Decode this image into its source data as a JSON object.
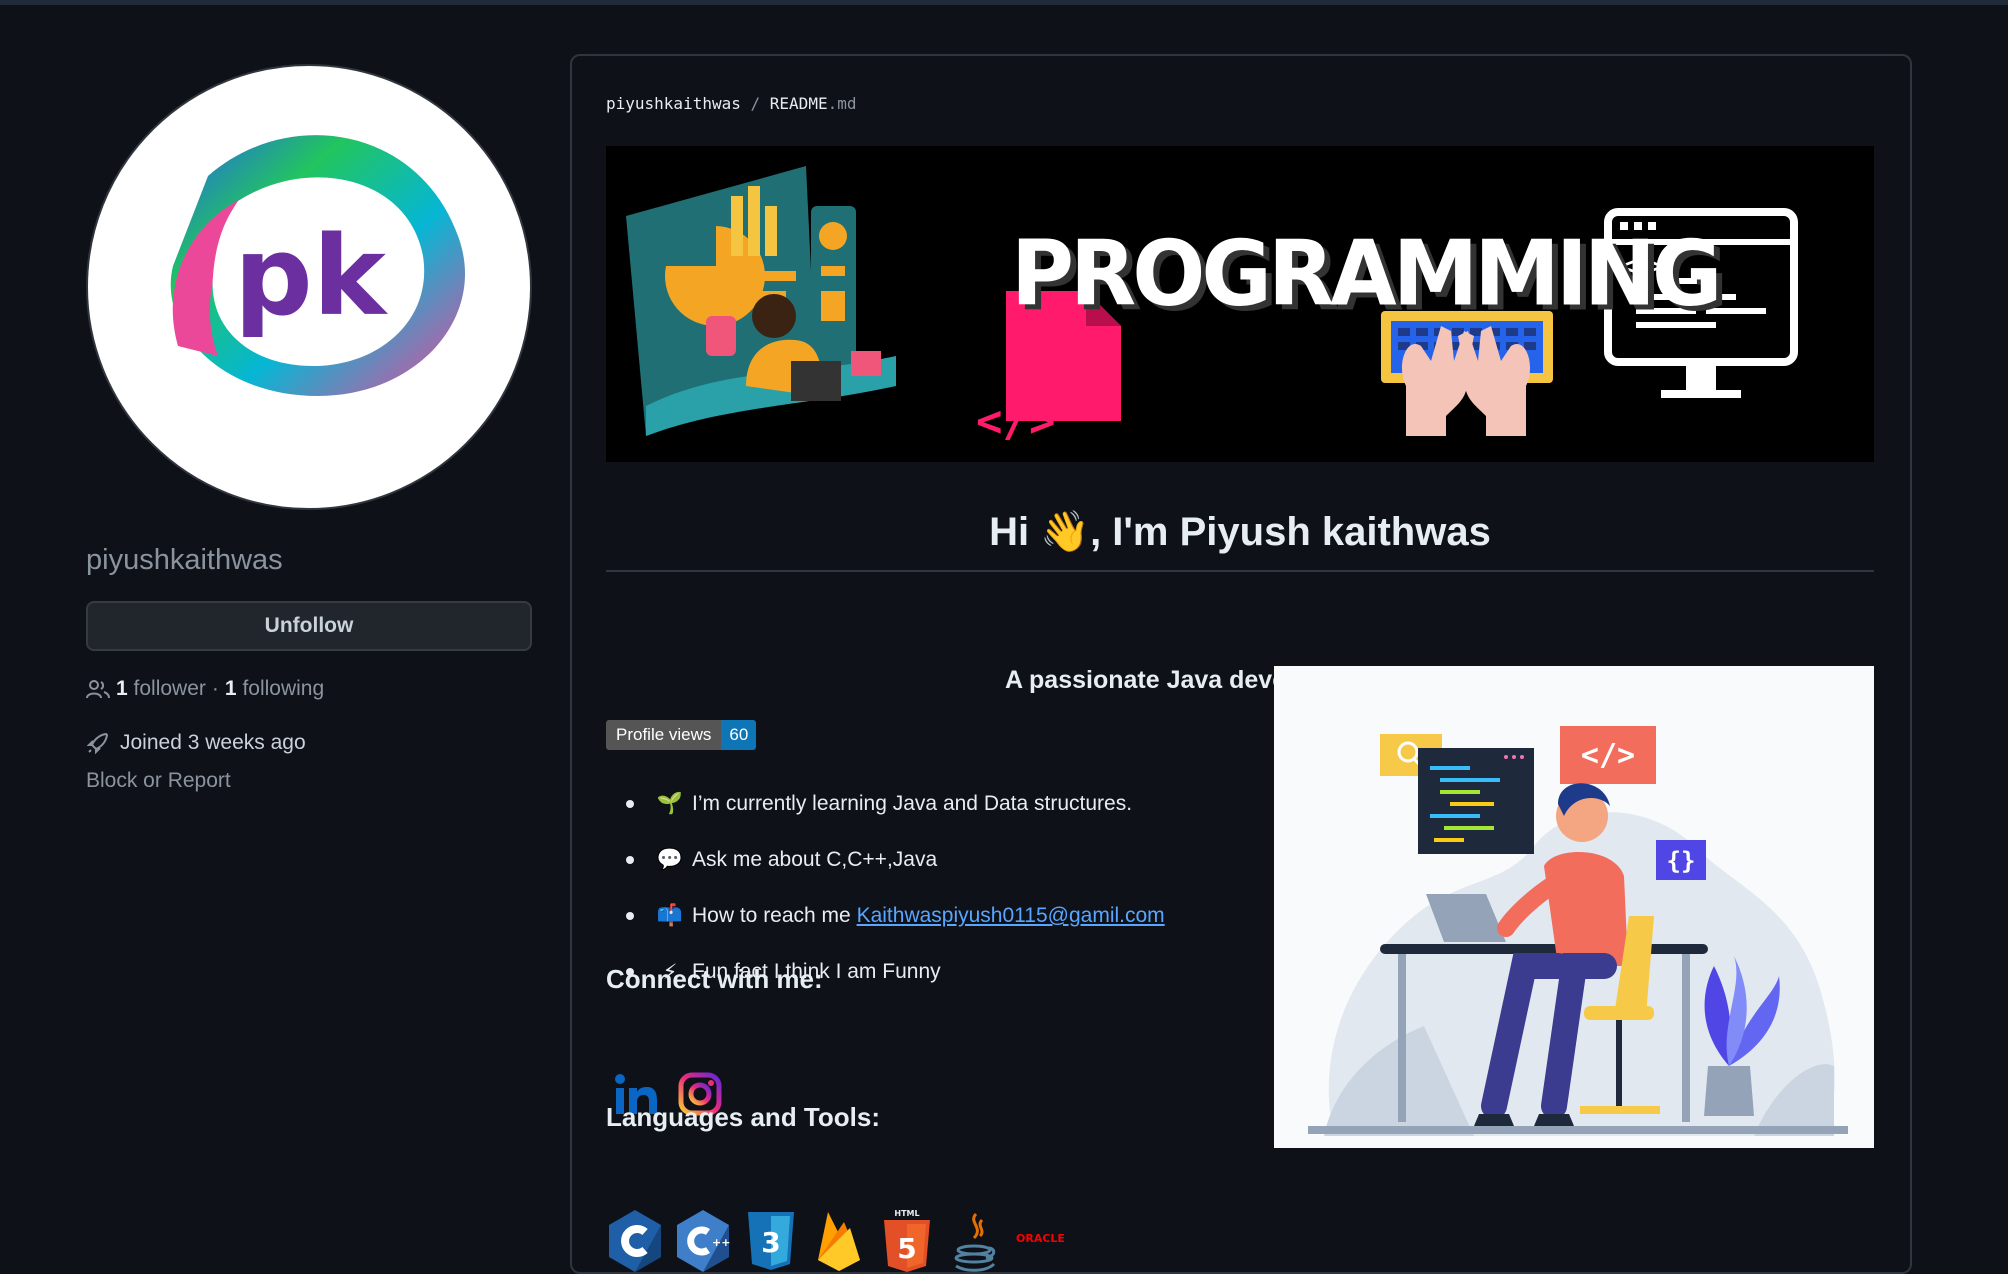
{
  "profile": {
    "avatar_text": "pk",
    "username": "piyushkaithwas",
    "unfollow_label": "Unfollow",
    "followers_count": "1",
    "followers_label": "follower",
    "separator": "·",
    "following_count": "1",
    "following_label": "following",
    "joined_label": "Joined",
    "joined_value": "3 weeks ago",
    "block_report": "Block or Report"
  },
  "readme": {
    "crumb_user": "piyushkaithwas",
    "crumb_sep": "/",
    "crumb_file": "README",
    "crumb_ext": ".md",
    "banner_text": "PROGRAMMING",
    "heading": "Hi 👋, I'm Piyush kaithwas",
    "subtitle": "A passionate Java developer from India",
    "badge_label": "Profile views",
    "badge_count": "60",
    "facts": [
      {
        "icon": "seedling-icon",
        "glyph": "🌱",
        "prefix": "I’m currently learning ",
        "bold": "Java and Data structures.",
        "link": ""
      },
      {
        "icon": "speech-bubble-icon",
        "glyph": "💬",
        "prefix": "Ask me about ",
        "bold": "C,C++,Java",
        "link": ""
      },
      {
        "icon": "mailbox-icon",
        "glyph": "📫",
        "prefix": "How to reach me ",
        "bold": "",
        "link": "Kaithwaspiyush0115@gamil.com"
      },
      {
        "icon": "lightning-icon",
        "glyph": "⚡",
        "prefix": "Fun fact ",
        "bold": "I think I am Funny",
        "link": ""
      }
    ],
    "connect_heading": "Connect with me:",
    "tools_heading": "Languages and Tools:",
    "social": [
      "linkedin-icon",
      "instagram-icon"
    ],
    "tools": [
      "c-icon",
      "cplusplus-icon",
      "css3-icon",
      "firebase-icon",
      "html5-icon",
      "java-icon",
      "oracle-icon"
    ],
    "tool_text": {
      "html": "HTML",
      "oracle": "ORACLE"
    }
  },
  "colors": {
    "background": "#0e1117",
    "link": "#58a6ff",
    "badge_count_bg": "#0e75b6"
  }
}
